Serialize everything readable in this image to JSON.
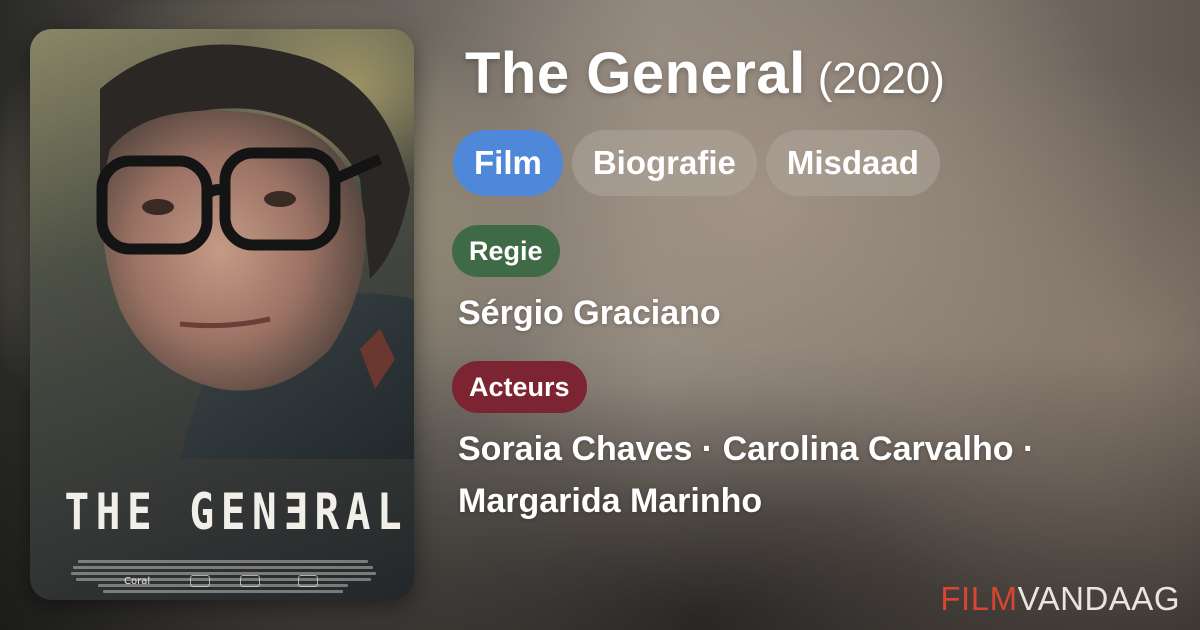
{
  "movie": {
    "title": "The General",
    "year": "(2020)"
  },
  "genres": [
    {
      "label": "Film",
      "primary": true
    },
    {
      "label": "Biografie",
      "primary": false
    },
    {
      "label": "Misdaad",
      "primary": false
    }
  ],
  "director": {
    "label": "Regie",
    "name": "Sérgio Graciano"
  },
  "cast": {
    "label": "Acteurs",
    "line1": "Soraia Chaves · Carolina Carvalho ·",
    "line2": "Margarida Marinho"
  },
  "poster": {
    "title": "THE GENƎRAL",
    "studio_logo": "Coral"
  },
  "brand": {
    "part1": "FILM",
    "part2": "VANDAAG"
  },
  "colors": {
    "genre_primary": "#4f88d8",
    "regie_label": "#3f6a46",
    "acteurs_label": "#7c2432",
    "brand_accent": "#d9452f"
  }
}
